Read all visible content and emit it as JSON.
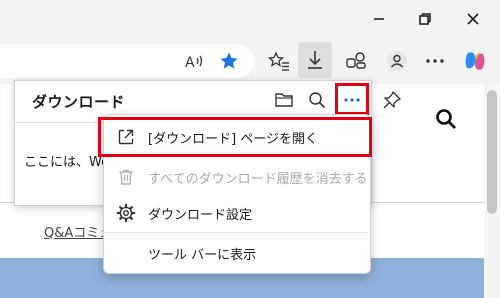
{
  "colors": {
    "highlight": "#e60012",
    "accent_blue": "#1a73e8",
    "disabled_text": "#a8a8a8"
  },
  "titlebar": {
    "minimize_icon": "minimize-icon",
    "restore_icon": "restore-icon",
    "close_icon": "close-icon"
  },
  "toolbar": {
    "read_aloud_icon": "read-aloud-icon",
    "favorite_icon": "star-filled-icon",
    "favorites_icon": "favorites-list-icon",
    "downloads_icon": "download-icon",
    "extensions_icon": "extensions-icon",
    "profile_icon": "profile-icon",
    "settings_more_icon": "ellipsis-icon",
    "copilot_icon": "copilot-icon"
  },
  "downloads_panel": {
    "title": "ダウンロード",
    "body_text": "ここには、We",
    "folder_icon": "folder-icon",
    "search_icon": "search-icon",
    "more_icon": "ellipsis-icon",
    "pin_icon": "pin-icon"
  },
  "menu": {
    "items": [
      {
        "label": "[ダウンロード] ページを開く",
        "icon": "open-external-icon",
        "enabled": true
      },
      {
        "label": "すべてのダウンロード履歴を消去する",
        "icon": "trash-icon",
        "enabled": false
      },
      {
        "label": "ダウンロード設定",
        "icon": "gear-icon",
        "enabled": true
      },
      {
        "label": "ツール バーに表示",
        "icon": "",
        "enabled": true
      }
    ]
  },
  "page": {
    "link_text": "Q&Aコミュ"
  }
}
